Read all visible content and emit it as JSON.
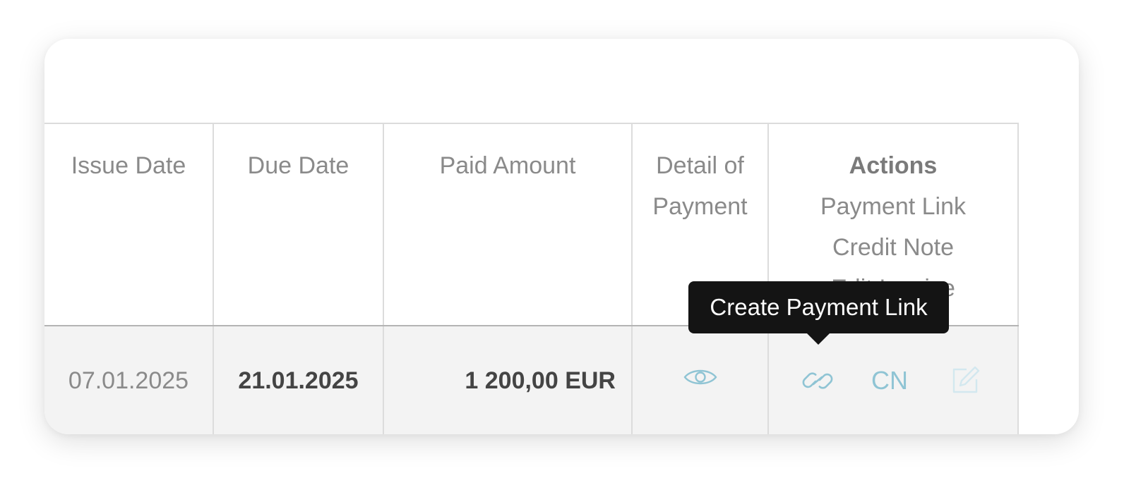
{
  "table": {
    "headers": {
      "issue_date": "Issue Date",
      "due_date": "Due Date",
      "paid_amount": "Paid Amount",
      "detail_line1": "Detail of",
      "detail_line2": "Payment",
      "actions_title": "Actions",
      "actions_payment_link": "Payment Link",
      "actions_credit_note": "Credit Note",
      "actions_edit_invoice": "Edit Invoice"
    },
    "rows": [
      {
        "issue_date": "07.01.2025",
        "due_date": "21.01.2025",
        "paid_amount": "1 200,00 EUR",
        "detail_icon": "eye-icon",
        "actions": {
          "payment_link_icon": "link-icon",
          "credit_note_label": "CN",
          "edit_icon": "edit-icon"
        }
      }
    ]
  },
  "tooltip": {
    "text": "Create Payment Link"
  },
  "colors": {
    "accent": "#8fc4d4",
    "tooltip_bg": "#141414",
    "row_bg": "#f3f3f3",
    "border": "#dcdcdc"
  }
}
